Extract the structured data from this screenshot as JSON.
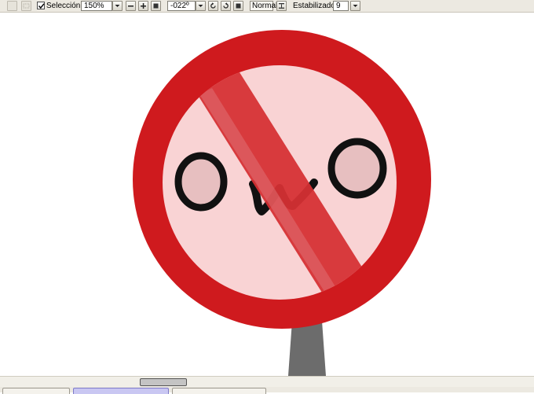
{
  "toolbar": {
    "selection_label": "Selección",
    "selection_checked": true,
    "zoom_value": "150%",
    "rotation_value": "-022º",
    "blend_mode": "Normal",
    "stabilizer_label": "Estabilizador",
    "stabilizer_value": "9"
  },
  "icons": {
    "zoom_dropdown": "chevron-down-icon",
    "zoom_out": "minus-icon",
    "zoom_in": "plus-icon",
    "zoom_reset": "square-icon",
    "rotation_dropdown": "chevron-down-icon",
    "rotate_ccw": "rotate-ccw-icon",
    "rotate_cw": "rotate-cw-icon",
    "rotation_reset": "square-icon",
    "flip": "flip-horizontal-icon",
    "stabilizer_dropdown": "chevron-down-icon"
  },
  "colors": {
    "sign_red": "#cf1a1e",
    "sign_inner": "#f9d3d4",
    "slash_red": "#d63033",
    "eye_fill": "#e7bfc0",
    "ink": "#111111",
    "pole": "#6c6c6c",
    "active_tab": "#c9c7f2"
  },
  "bottom_tabs": [
    {
      "active": false
    },
    {
      "active": true
    },
    {
      "active": false
    }
  ]
}
